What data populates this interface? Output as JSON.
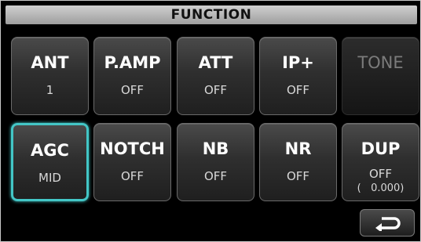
{
  "title": "FUNCTION",
  "row1": [
    {
      "name": "ANT",
      "value": "1"
    },
    {
      "name": "P.AMP",
      "value": "OFF"
    },
    {
      "name": "ATT",
      "value": "OFF"
    },
    {
      "name": "IP+",
      "value": "OFF"
    },
    {
      "name": "TONE",
      "value": ""
    }
  ],
  "row2": [
    {
      "name": "AGC",
      "value": "MID"
    },
    {
      "name": "NOTCH",
      "value": "OFF"
    },
    {
      "name": "NB",
      "value": "OFF"
    },
    {
      "name": "NR",
      "value": "OFF"
    },
    {
      "name": "DUP",
      "value": "OFF",
      "sub": "(   0.000)"
    }
  ],
  "icons": {
    "back": "return-arrow-icon"
  },
  "colors": {
    "accent": "#43c6c6",
    "disabled_text": "#7b7b7b"
  }
}
